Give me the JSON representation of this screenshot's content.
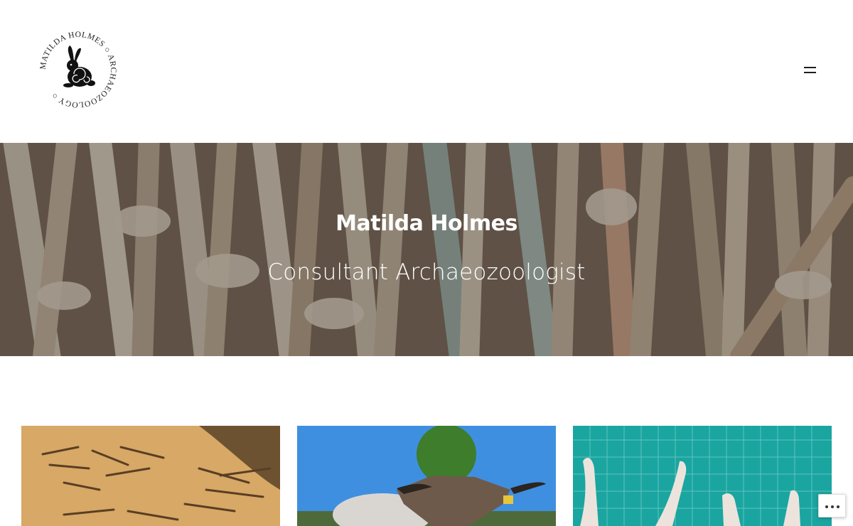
{
  "header": {
    "logo_text": "MATILDA HOLMES ○ ARCHAEOZOOLOGY ○",
    "menu_icon": "menu-icon"
  },
  "hero": {
    "title": "Matilda Holmes",
    "subtitle": "Consultant Archaeozoologist"
  },
  "posts": [
    {
      "image": "bone-fragments-on-sand-thumbnail"
    },
    {
      "image": "cattle-head-thumbnail"
    },
    {
      "image": "bones-on-cutting-mat-thumbnail"
    }
  ],
  "overlay": {
    "more_icon": "more-horizontal-icon"
  },
  "colors": {
    "text": "#1e1e1e",
    "hero_tint": "#28221e",
    "mat_green": "#1aa5a0",
    "sky": "#3f8fe0"
  }
}
